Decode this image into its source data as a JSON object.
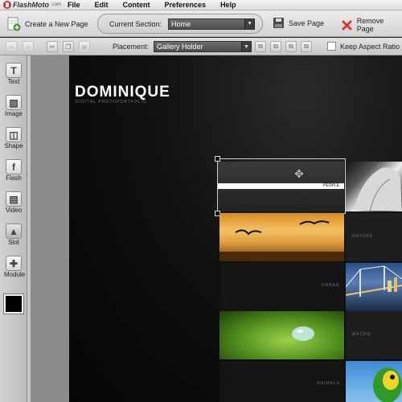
{
  "app": {
    "logo_text": "FlashMoto",
    "logo_domain": ".com"
  },
  "menu": [
    "File",
    "Edit",
    "Content",
    "Preferences",
    "Help"
  ],
  "toolbar": {
    "create_page_label": "Create a New Page",
    "current_section_label": "Current Section:",
    "current_section_value": "Home",
    "save_label": "Save Page",
    "remove_label": "Remove Page"
  },
  "toolbar2": {
    "placement_label": "Placement:",
    "placement_value": "Gallery Holder",
    "keep_aspect_label": "Keep Aspect Ratio",
    "keep_aspect_checked": false
  },
  "tools": [
    {
      "label": "Text",
      "icon": "text-icon",
      "glyph": "T"
    },
    {
      "label": "Image",
      "icon": "image-icon",
      "glyph": "▧"
    },
    {
      "label": "Shape",
      "icon": "shape-icon",
      "glyph": "◫"
    },
    {
      "label": "Flash",
      "icon": "flash-icon",
      "glyph": "f"
    },
    {
      "label": "Video",
      "icon": "video-icon",
      "glyph": "▤"
    },
    {
      "label": "Slot",
      "icon": "slot-icon",
      "glyph": "▲"
    },
    {
      "label": "Module",
      "icon": "module-icon",
      "glyph": "✚"
    }
  ],
  "colors": {
    "canvas_bg": "#0a0a0a",
    "remove_icon": "#d83a2a",
    "swatch": "#000000"
  },
  "site": {
    "title": "DOMINIQUE",
    "subtitle": "DIGITAL PHOTOPORTFOLIO"
  },
  "gallery": {
    "labels": [
      "PEOPLE",
      "NATURE",
      "URBAN",
      "MACRO",
      "ANIMALS"
    ]
  }
}
